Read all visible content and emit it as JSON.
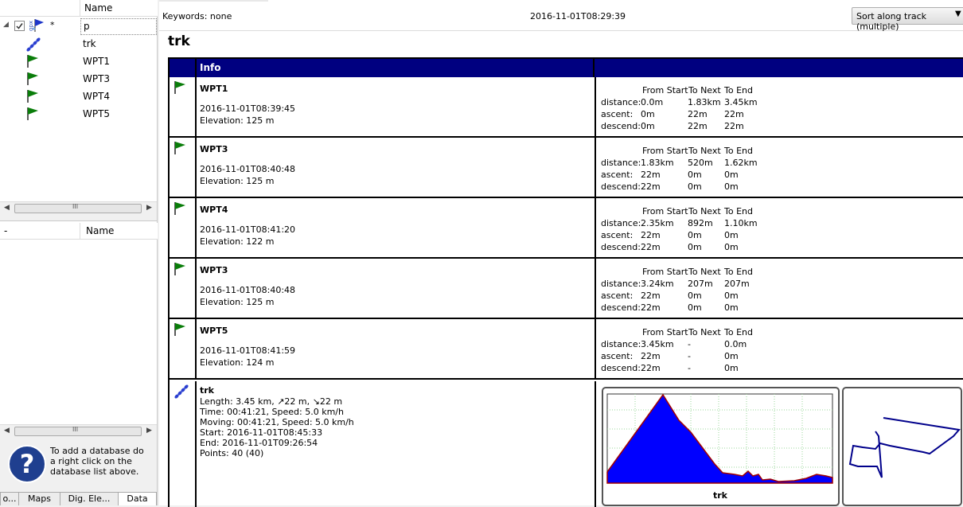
{
  "tree": {
    "header_name": "Name",
    "project": {
      "marker": "*",
      "name": "p",
      "checked": true,
      "icon": "project-icon"
    },
    "items": [
      {
        "name": "trk",
        "icon": "track-icon"
      },
      {
        "name": "WPT1",
        "icon": "flag-icon"
      },
      {
        "name": "WPT3",
        "icon": "flag-icon"
      },
      {
        "name": "WPT4",
        "icon": "flag-icon"
      },
      {
        "name": "WPT5",
        "icon": "flag-icon"
      }
    ],
    "scroll_grip": "III"
  },
  "db_list": {
    "header_dash": "-",
    "header_name": "Name",
    "scroll_grip": "III"
  },
  "help": {
    "icon": "question-mark-icon",
    "text": "To add a database do a right click on the database list above."
  },
  "bottom_tabs": [
    {
      "label": "o...",
      "active": false
    },
    {
      "label": "Maps",
      "active": false
    },
    {
      "label": "Dig. Ele...",
      "active": false
    },
    {
      "label": "Data",
      "active": true
    }
  ],
  "details": {
    "keywords": "Keywords: none",
    "timestamp": "2016-11-01T08:29:39",
    "sort_select": "Sort along track (multiple)",
    "title": "trk",
    "table_header": "Info",
    "stat_headers": [
      "From Start",
      "To Next",
      "To End"
    ],
    "stat_labels": [
      "distance:",
      "ascent:",
      "descend:"
    ],
    "waypoints": [
      {
        "name": "WPT1",
        "time": "2016-11-01T08:39:45",
        "elevation": "Elevation: 125 m",
        "distance": [
          "0.0m",
          "1.83km",
          "3.45km"
        ],
        "ascent": [
          "0m",
          "22m",
          "22m"
        ],
        "descend": [
          "0m",
          "22m",
          "22m"
        ]
      },
      {
        "name": "WPT3",
        "time": "2016-11-01T08:40:48",
        "elevation": "Elevation: 125 m",
        "distance": [
          "1.83km",
          "520m",
          "1.62km"
        ],
        "ascent": [
          "22m",
          "0m",
          "0m"
        ],
        "descend": [
          "22m",
          "0m",
          "0m"
        ]
      },
      {
        "name": "WPT4",
        "time": "2016-11-01T08:41:20",
        "elevation": "Elevation: 122 m",
        "distance": [
          "2.35km",
          "892m",
          "1.10km"
        ],
        "ascent": [
          "22m",
          "0m",
          "0m"
        ],
        "descend": [
          "22m",
          "0m",
          "0m"
        ]
      },
      {
        "name": "WPT3",
        "time": "2016-11-01T08:40:48",
        "elevation": "Elevation: 125 m",
        "distance": [
          "3.24km",
          "207m",
          "207m"
        ],
        "ascent": [
          "22m",
          "0m",
          "0m"
        ],
        "descend": [
          "22m",
          "0m",
          "0m"
        ]
      },
      {
        "name": "WPT5",
        "time": "2016-11-01T08:41:59",
        "elevation": "Elevation: 124 m",
        "distance": [
          "3.45km",
          "-",
          "0.0m"
        ],
        "ascent": [
          "22m",
          "-",
          "0m"
        ],
        "descend": [
          "22m",
          "-",
          "0m"
        ]
      }
    ],
    "track": {
      "name": "trk",
      "lines": [
        "Length: 3.45 km, ↗22 m, ↘22 m",
        "Time: 00:41:21, Speed: 5.0 km/h",
        "Moving: 00:41:21, Speed: 5.0 km/h",
        "Start: 2016-11-01T08:45:33",
        "End: 2016-11-01T09:26:54",
        "Points: 40 (40)"
      ],
      "profile_label": "trk",
      "colors": {
        "profile_fill": "#0000ff",
        "profile_line": "#a00000",
        "map_line": "#00008b",
        "header_bg": "#000080",
        "flag": "#0a7d0a"
      }
    }
  }
}
